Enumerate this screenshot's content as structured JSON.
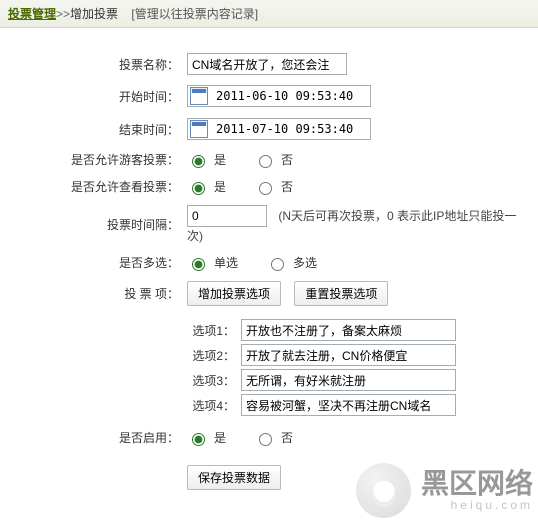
{
  "header": {
    "crumb1": "投票管理",
    "sep": ">>",
    "crumb2": "增加投票",
    "note": "[管理以往投票内容记录]"
  },
  "labels": {
    "name": "投票名称：",
    "start": "开始时间：",
    "end": "结束时间：",
    "guest": "是否允许游客投票：",
    "view": "是否允许查看投票：",
    "interval": "投票时间隔：",
    "multi": "是否多选：",
    "items": "投 票 项：",
    "enable": "是否启用："
  },
  "fields": {
    "name_value": "CN域名开放了，您还会注",
    "start_value": "2011-06-10 09:53:40",
    "end_value": "2011-07-10 09:53:40",
    "interval_value": "0",
    "interval_hint": "(N天后可再次投票，0 表示此IP地址只能投一次)"
  },
  "radios": {
    "yes": "是",
    "no": "否",
    "single": "单选",
    "multi": "多选"
  },
  "buttons": {
    "add_option": "增加投票选项",
    "reset_option": "重置投票选项",
    "save": "保存投票数据"
  },
  "options": [
    {
      "label": "选项1：",
      "value": "开放也不注册了，备案太麻烦"
    },
    {
      "label": "选项2：",
      "value": "开放了就去注册，CN价格便宜"
    },
    {
      "label": "选项3：",
      "value": "无所谓，有好米就注册"
    },
    {
      "label": "选项4：",
      "value": "容易被河蟹，坚决不再注册CN域名"
    }
  ],
  "watermark": {
    "text": "黑区网络",
    "sub": "heiqu.com"
  }
}
